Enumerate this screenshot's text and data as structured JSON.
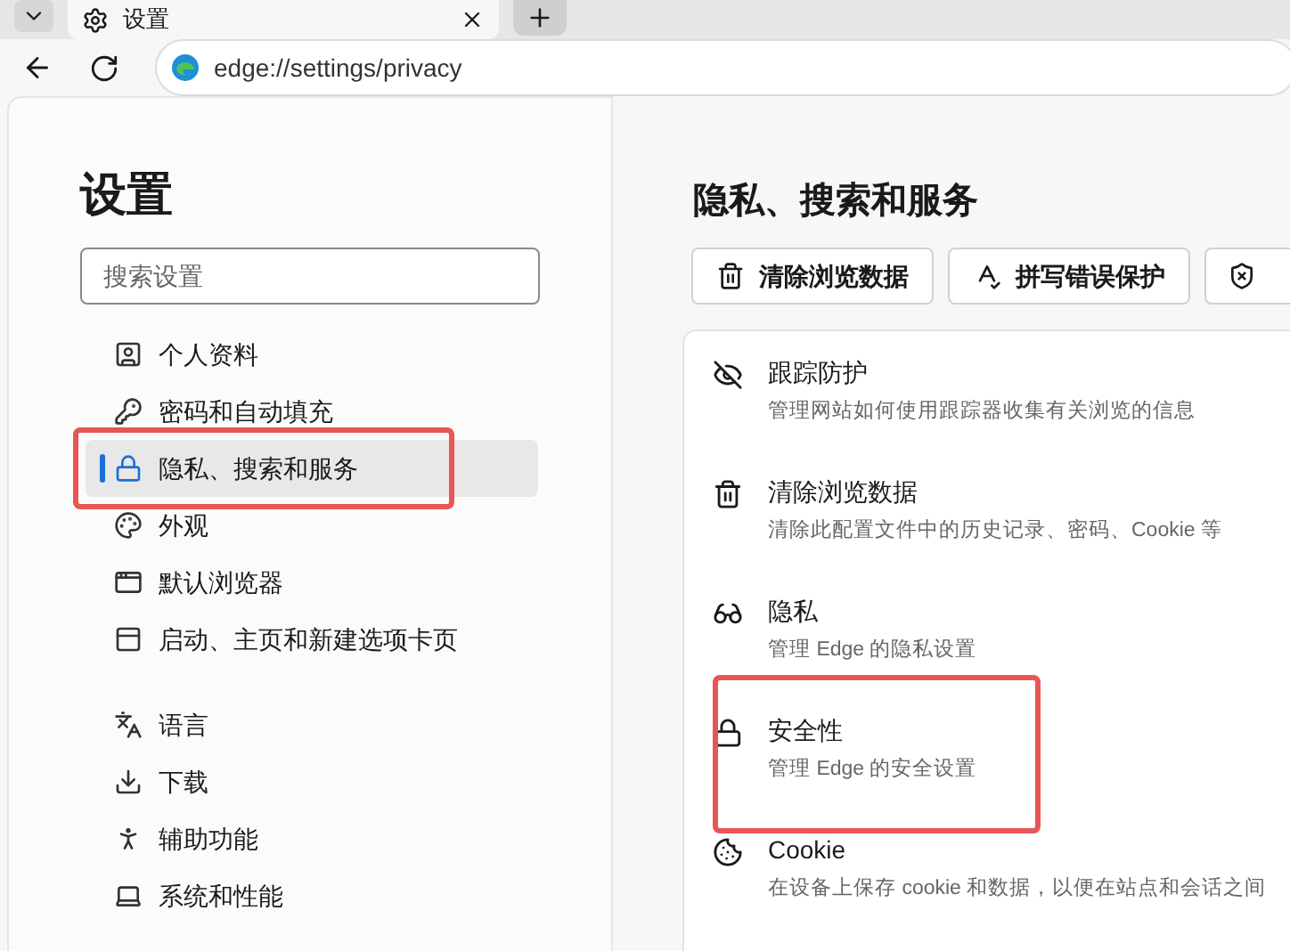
{
  "browser": {
    "tab": {
      "title": "设置"
    },
    "address": "edge://settings/privacy"
  },
  "sidebar": {
    "title": "设置",
    "search": {
      "placeholder": "搜索设置"
    },
    "groups": [
      [
        {
          "label": "个人资料",
          "selected": false,
          "highlighted": false
        },
        {
          "label": "密码和自动填充",
          "selected": false,
          "highlighted": false
        },
        {
          "label": "隐私、搜索和服务",
          "selected": true,
          "highlighted": true
        },
        {
          "label": "外观",
          "selected": false,
          "highlighted": false
        },
        {
          "label": "默认浏览器",
          "selected": false,
          "highlighted": false
        },
        {
          "label": "启动、主页和新建选项卡页",
          "selected": false,
          "highlighted": false
        }
      ],
      [
        {
          "label": "语言",
          "selected": false,
          "highlighted": false
        },
        {
          "label": "下载",
          "selected": false,
          "highlighted": false
        },
        {
          "label": "辅助功能",
          "selected": false,
          "highlighted": false
        },
        {
          "label": "系统和性能",
          "selected": false,
          "highlighted": false
        }
      ]
    ]
  },
  "main": {
    "title": "隐私、搜索和服务",
    "toolbar": [
      "清除浏览数据",
      "拼写错误保护"
    ],
    "items": [
      {
        "title": "跟踪防护",
        "description": "管理网站如何使用跟踪器收集有关浏览的信息",
        "highlighted": false
      },
      {
        "title": "清除浏览数据",
        "description": "清除此配置文件中的历史记录、密码、Cookie 等",
        "highlighted": false
      },
      {
        "title": "隐私",
        "description": "管理 Edge 的隐私设置",
        "highlighted": false
      },
      {
        "title": "安全性",
        "description": "管理 Edge 的安全设置",
        "highlighted": true
      },
      {
        "title": "Cookie",
        "description": "在设备上保存 cookie 和数据，以便在站点和会话之间",
        "highlighted": false
      }
    ]
  }
}
